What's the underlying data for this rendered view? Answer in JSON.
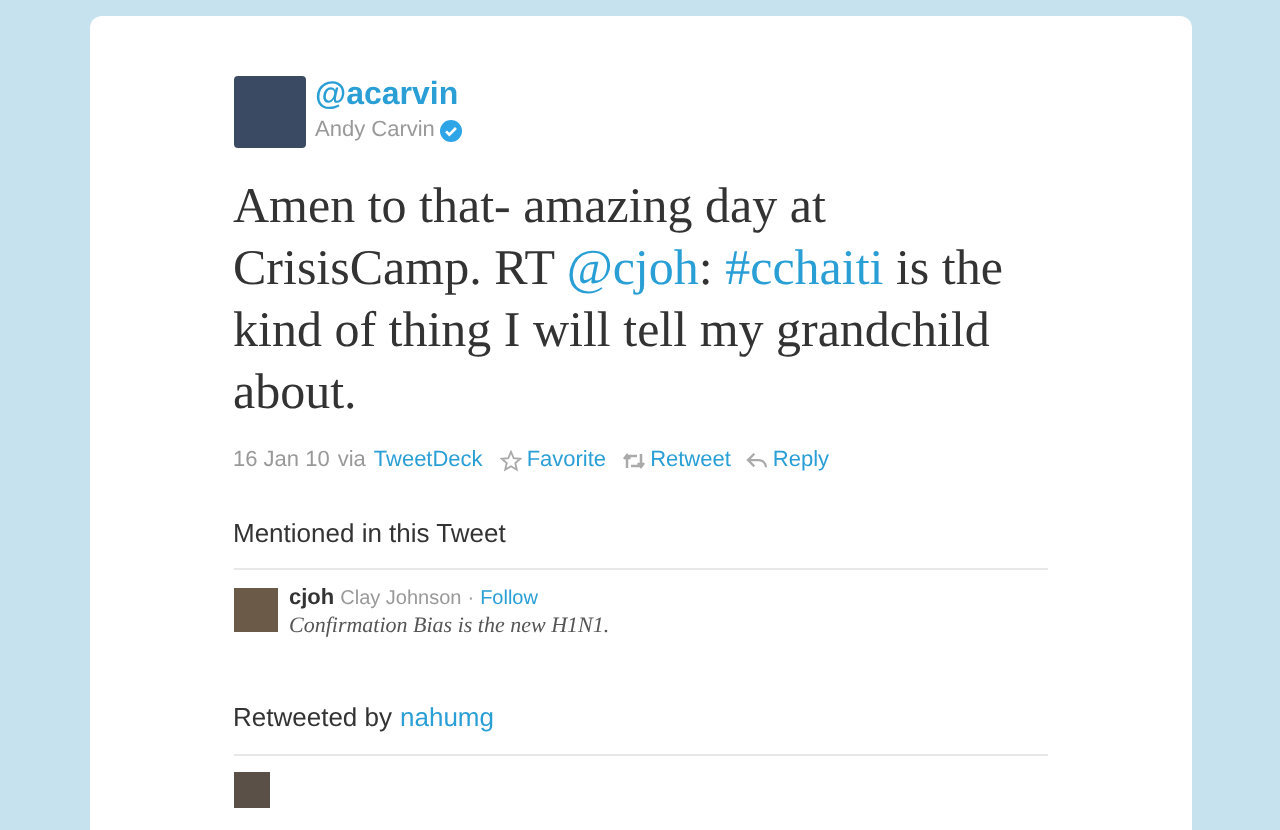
{
  "author": {
    "handle": "@acarvin",
    "name": "Andy Carvin",
    "verified": true
  },
  "tweet": [
    {
      "kind": "text",
      "text": "Amen to that- amazing day at CrisisCamp. RT "
    },
    {
      "kind": "link",
      "text": "@cjoh"
    },
    {
      "kind": "text",
      "text": ": "
    },
    {
      "kind": "link",
      "text": "#cchaiti"
    },
    {
      "kind": "text",
      "text": " is the kind of thing I will tell my grandchild about."
    }
  ],
  "meta": {
    "date": "16 Jan 10",
    "via": "via",
    "client": "TweetDeck",
    "actions": [
      {
        "kind": "favorite",
        "label": "Favorite"
      },
      {
        "kind": "retweet",
        "label": "Retweet"
      },
      {
        "kind": "reply",
        "label": "Reply"
      }
    ]
  },
  "mentioned": {
    "title": "Mentioned in this Tweet",
    "users": [
      {
        "handle": "cjoh",
        "name": "Clay Johnson",
        "separator": "·",
        "follow": "Follow",
        "bio": "Confirmation Bias is the new H1N1."
      }
    ]
  },
  "retweeted": {
    "label": "Retweeted by",
    "user": "nahumg"
  }
}
